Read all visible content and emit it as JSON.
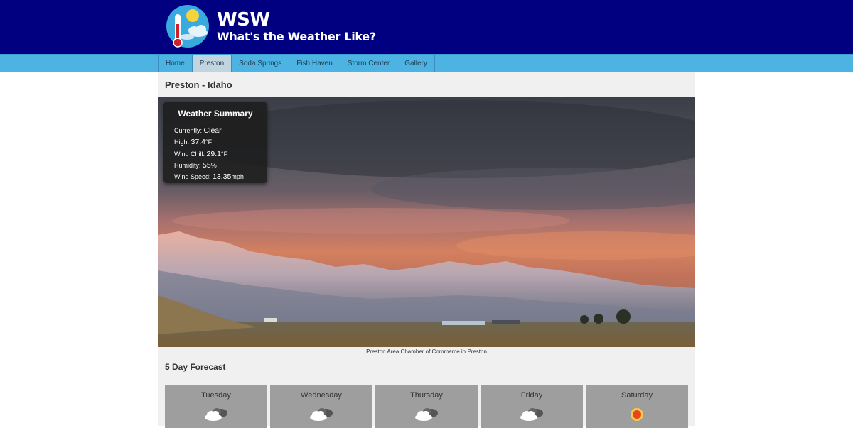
{
  "site": {
    "title": "WSW",
    "tagline": "What's the Weather Like?"
  },
  "nav": {
    "items": [
      {
        "label": "Home",
        "active": false
      },
      {
        "label": "Preston",
        "active": true
      },
      {
        "label": "Soda Springs",
        "active": false
      },
      {
        "label": "Fish Haven",
        "active": false
      },
      {
        "label": "Storm Center",
        "active": false
      },
      {
        "label": "Gallery",
        "active": false
      }
    ]
  },
  "page": {
    "heading": "Preston - Idaho",
    "photo_caption": "Preston Area Chamber of Commerce in Preston"
  },
  "summary": {
    "title": "Weather Summary",
    "currently_label": "Currently:",
    "currently_value": "Clear",
    "high_label": "High:",
    "high_value": "37.4",
    "high_unit": "°F",
    "windchill_label": "Wind Chill:",
    "windchill_value": "29.1",
    "windchill_unit": "°F",
    "humidity_label": "Humidity:",
    "humidity_value": "55",
    "humidity_unit": "%",
    "windspeed_label": "Wind Speed:",
    "windspeed_value": "13.35",
    "windspeed_unit": "mph"
  },
  "forecast": {
    "heading": "5 Day Forecast",
    "days": [
      {
        "day": "Tuesday",
        "icon": "partly-cloudy-icon"
      },
      {
        "day": "Wednesday",
        "icon": "partly-cloudy-icon"
      },
      {
        "day": "Thursday",
        "icon": "partly-cloudy-icon"
      },
      {
        "day": "Friday",
        "icon": "partly-cloudy-icon"
      },
      {
        "day": "Saturday",
        "icon": "sun-icon"
      }
    ]
  },
  "colors": {
    "header": "#000080",
    "nav": "#4db3e3",
    "nav_active": "#c2d4e0",
    "card": "#9e9e9e"
  }
}
